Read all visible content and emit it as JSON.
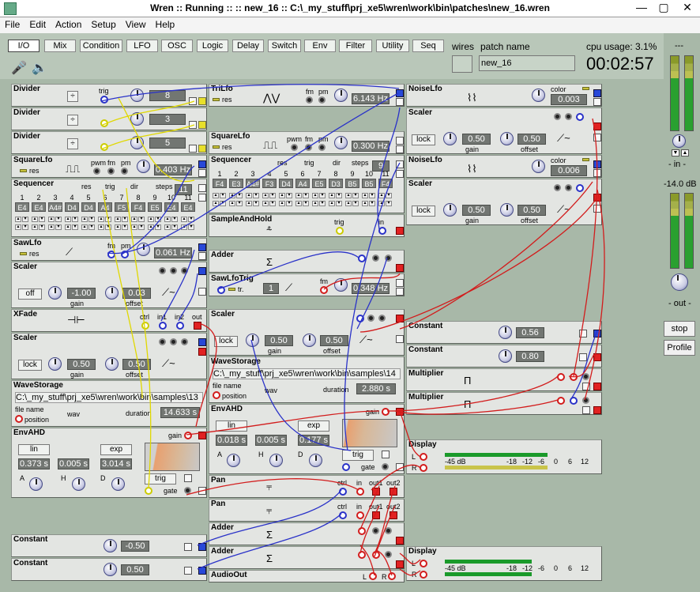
{
  "window": {
    "title": "Wren :: Running :: :: new_16 :: C:\\_my_stuff\\prj_xe5\\wren\\work\\bin\\patches\\new_16.wren"
  },
  "menu": [
    "File",
    "Edit",
    "Action",
    "Setup",
    "View",
    "Help"
  ],
  "tabs": [
    "I/O",
    "Mix",
    "Condition",
    "LFO",
    "OSC",
    "Logic",
    "Delay",
    "Switch",
    "Env",
    "Filter",
    "Utility",
    "Seq"
  ],
  "wires_label": "wires",
  "patch_name_label": "patch name",
  "patch_name": "new_16",
  "cpu_usage": "cpu usage: 3.1%",
  "clock": "00:02:57",
  "right": {
    "top_dash": "---",
    "in_label": "- in -",
    "db": "-14.0 dB",
    "dash2": "---",
    "out_label": "- out -",
    "stop": "stop",
    "profile": "Profile"
  },
  "modules": {
    "divider1": {
      "name": "Divider",
      "value": "8",
      "trig": "trig"
    },
    "divider2": {
      "name": "Divider",
      "value": "3"
    },
    "divider3": {
      "name": "Divider",
      "value": "5"
    },
    "squarelfo1": {
      "name": "SquareLfo",
      "res": "res",
      "pwm": "pwm",
      "fm": "fm",
      "pm": "pm",
      "rate": "0.403 Hz"
    },
    "seq1": {
      "name": "Sequencer",
      "res": "res",
      "trig": "trig",
      "dir": "dir",
      "steps": "steps",
      "steps_val": "11",
      "nums": [
        "1",
        "2",
        "3",
        "4",
        "5",
        "6",
        "7",
        "8",
        "9",
        "10",
        "11"
      ],
      "notes": [
        "E4",
        "E4",
        "A4#",
        "D4",
        "D4",
        "A4",
        "F5",
        "F4",
        "E5",
        "E4",
        "E4"
      ]
    },
    "sawlfo1": {
      "name": "SawLfo",
      "res": "res",
      "fm": "fm",
      "pm": "pm",
      "rate": "0.061 Hz"
    },
    "scaler1": {
      "name": "Scaler",
      "mode": "off",
      "gain": "-1.00",
      "offset": "0.03",
      "gain_lbl": "gain",
      "offset_lbl": "offset"
    },
    "xfade": {
      "name": "XFade",
      "ctrl": "ctrl",
      "in1": "in1",
      "in2": "in2",
      "out": "out"
    },
    "scaler2": {
      "name": "Scaler",
      "mode": "lock",
      "gain": "0.50",
      "offset": "0.50",
      "gain_lbl": "gain",
      "offset_lbl": "offset"
    },
    "wave1": {
      "name": "WaveStorage",
      "path": "C:\\_my_stuff\\prj_xe5\\wren\\work\\bin\\samples\\13",
      "file_name": "file name",
      "ext": "wav",
      "position": "position",
      "duration_lbl": "duration",
      "duration": "14.633 s"
    },
    "env1": {
      "name": "EnvAHD",
      "gain": "gain",
      "a_mode": "lin",
      "d_mode": "exp",
      "a": "0.373 s",
      "h": "0.005 s",
      "d": "3.014 s",
      "trig": "trig",
      "gate": "gate",
      "A": "A",
      "H": "H",
      "D": "D"
    },
    "const1": {
      "name": "Constant",
      "value": "-0.50"
    },
    "const2": {
      "name": "Constant",
      "value": "0.50"
    },
    "trilfo": {
      "name": "TriLfo",
      "res": "res",
      "fm": "fm",
      "pm": "pm",
      "rate": "6.143 Hz"
    },
    "squarelfo2": {
      "name": "SquareLfo",
      "res": "res",
      "pwm": "pwm",
      "fm": "fm",
      "pm": "pm",
      "rate": "0.300 Hz"
    },
    "seq2": {
      "name": "Sequencer",
      "res": "res",
      "trig": "trig",
      "dir": "dir",
      "steps": "steps",
      "steps_val": "9",
      "nums": [
        "1",
        "2",
        "3",
        "4",
        "5",
        "6",
        "7",
        "8",
        "9",
        "10",
        "11"
      ],
      "notes": [
        "F4",
        "E3",
        "A4#",
        "F3",
        "D4",
        "A4",
        "E5",
        "D3",
        "B5",
        "B5",
        "F4"
      ]
    },
    "sah": {
      "name": "SampleAndHold",
      "trig": "trig",
      "in": "in"
    },
    "adder1": {
      "name": "Adder"
    },
    "sawlfotrig": {
      "name": "SawLfoTrig",
      "tr": "tr.",
      "fm": "fm",
      "val": "1",
      "rate": "0.348 Hz"
    },
    "scaler3": {
      "name": "Scaler",
      "mode": "lock",
      "gain": "0.50",
      "offset": "0.50",
      "gain_lbl": "gain",
      "offset_lbl": "offset"
    },
    "wave2": {
      "name": "WaveStorage",
      "path": "C:\\_my_stuff\\prj_xe5\\wren\\work\\bin\\samples\\14",
      "file_name": "file name",
      "ext": "wav",
      "position": "position",
      "duration_lbl": "duration",
      "duration": "2.880 s"
    },
    "env2": {
      "name": "EnvAHD",
      "gain": "gain",
      "a_mode": "lin",
      "d_mode": "exp",
      "a": "0.018 s",
      "h": "0.005 s",
      "d": "0.177 s",
      "trig": "trig",
      "gate": "gate",
      "A": "A",
      "H": "H",
      "D": "D"
    },
    "pan1": {
      "name": "Pan",
      "ctrl": "ctrl",
      "in": "in",
      "out1": "out1",
      "out2": "out2"
    },
    "pan2": {
      "name": "Pan",
      "ctrl": "ctrl",
      "in": "in",
      "out1": "out1",
      "out2": "out2"
    },
    "adder2": {
      "name": "Adder"
    },
    "adder3": {
      "name": "Adder"
    },
    "audioout": {
      "name": "AudioOut",
      "l": "L",
      "r": "R"
    },
    "noiselfo1": {
      "name": "NoiseLfo",
      "color": "color",
      "value": "0.003"
    },
    "scaler4": {
      "name": "Scaler",
      "mode": "lock",
      "gain": "0.50",
      "offset": "0.50",
      "gain_lbl": "gain",
      "offset_lbl": "offset"
    },
    "noiselfo2": {
      "name": "NoiseLfo",
      "color": "color",
      "value": "0.006"
    },
    "scaler5": {
      "name": "Scaler",
      "mode": "lock",
      "gain": "0.50",
      "offset": "0.50",
      "gain_lbl": "gain",
      "offset_lbl": "offset"
    },
    "const3": {
      "name": "Constant",
      "value": "0.56"
    },
    "const4": {
      "name": "Constant",
      "value": "0.80"
    },
    "mult1": {
      "name": "Multiplier",
      "sym": "Π"
    },
    "mult2": {
      "name": "Multiplier",
      "sym": "Π"
    },
    "display1": {
      "name": "Display",
      "l": "L",
      "r": "R",
      "scale": [
        "-45 dB",
        "-18",
        "-12",
        "-6",
        "0",
        "6",
        "12"
      ]
    },
    "display2": {
      "name": "Display",
      "l": "L",
      "r": "R",
      "scale": [
        "-45 dB",
        "-18",
        "-12",
        "-6",
        "0",
        "6",
        "12"
      ]
    }
  }
}
